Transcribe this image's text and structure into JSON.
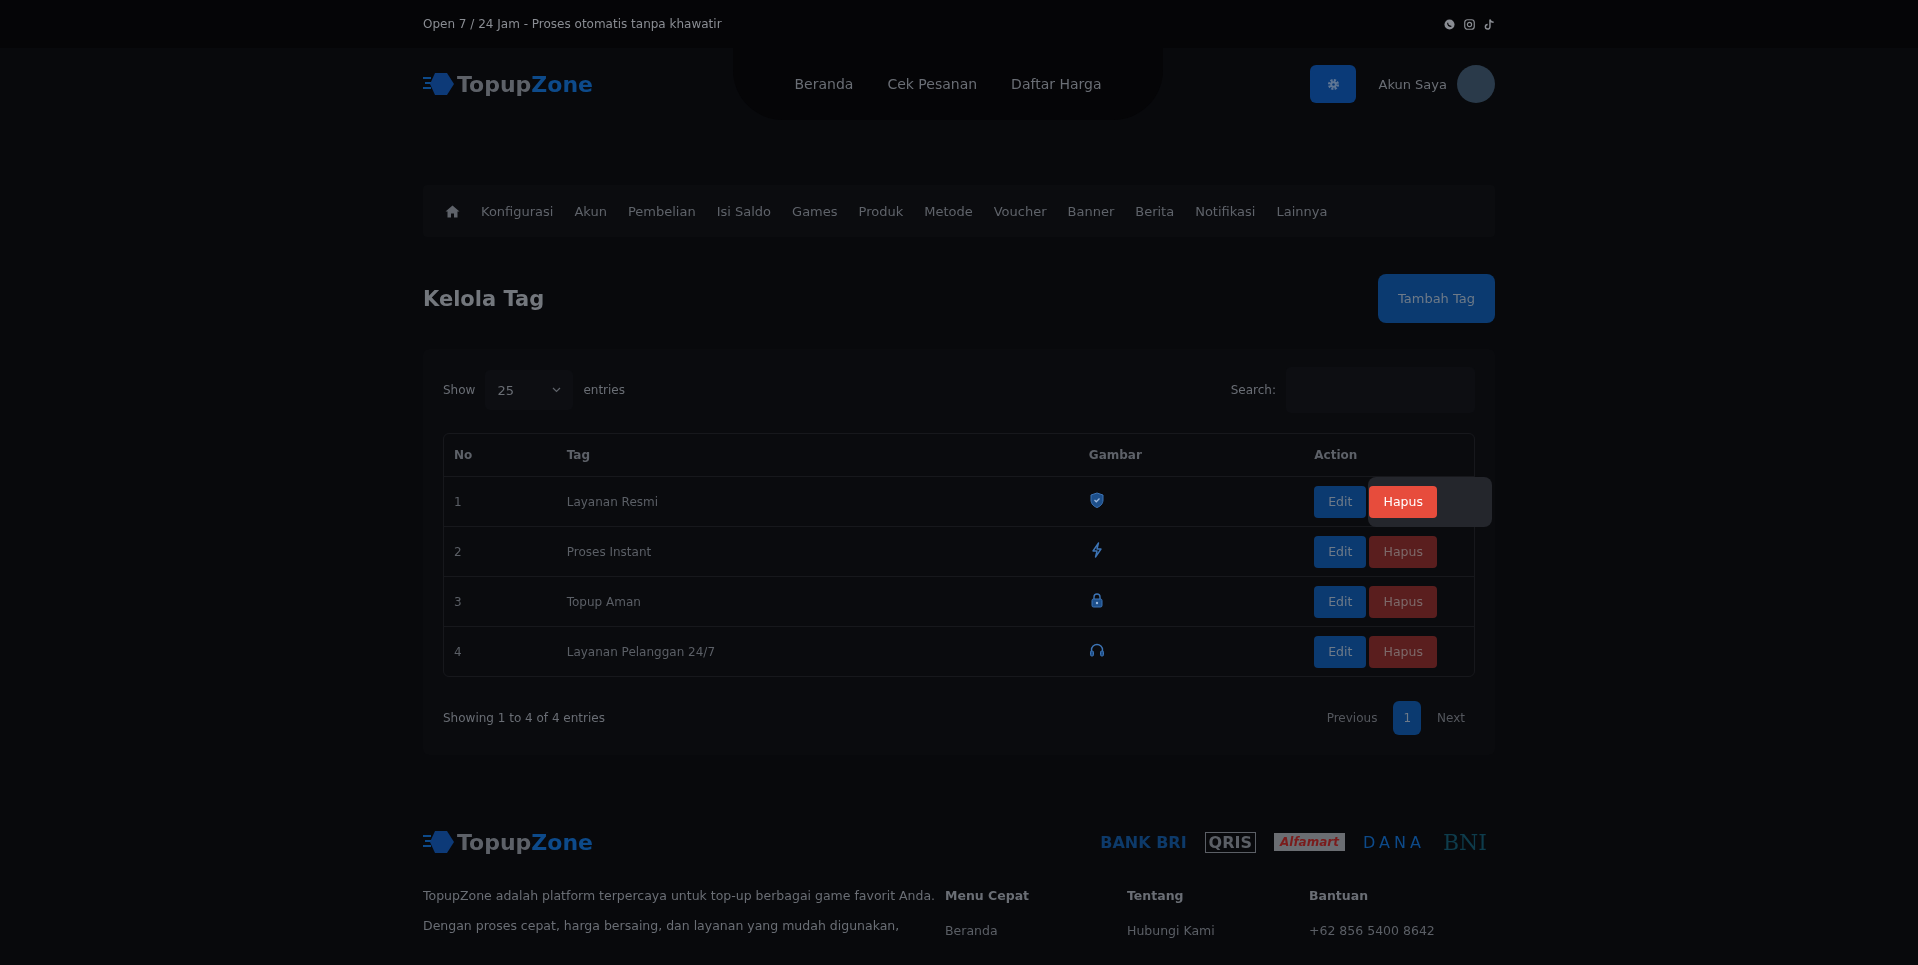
{
  "top_bar": {
    "text": "Open 7 / 24 Jam - Proses otomatis tanpa khawatir"
  },
  "header": {
    "logo": {
      "text": "Topup",
      "accent": "Zone"
    },
    "nav": [
      "Beranda",
      "Cek Pesanan",
      "Daftar Harga"
    ],
    "account": "Akun Saya"
  },
  "admin_menu": [
    "Konfigurasi",
    "Akun",
    "Pembelian",
    "Isi Saldo",
    "Games",
    "Produk",
    "Metode",
    "Voucher",
    "Banner",
    "Berita",
    "Notifikasi",
    "Lainnya"
  ],
  "page": {
    "title": "Kelola Tag",
    "add_button": "Tambah Tag"
  },
  "table_controls": {
    "show_label": "Show",
    "page_size": "25",
    "entries_label": "entries",
    "search_label": "Search:"
  },
  "table": {
    "columns": [
      "No",
      "Tag",
      "Gambar",
      "Action"
    ],
    "rows": [
      {
        "no": "1",
        "tag": "Layanan Resmi",
        "kind": "shield",
        "edit": "Edit",
        "delete": "Hapus",
        "highlighted": true
      },
      {
        "no": "2",
        "tag": "Proses Instant",
        "kind": "bolt",
        "edit": "Edit",
        "delete": "Hapus",
        "highlighted": false
      },
      {
        "no": "3",
        "tag": "Topup Aman",
        "kind": "lock",
        "edit": "Edit",
        "delete": "Hapus",
        "highlighted": false
      },
      {
        "no": "4",
        "tag": "Layanan Pelanggan 24/7",
        "kind": "headset",
        "edit": "Edit",
        "delete": "Hapus",
        "highlighted": false
      }
    ]
  },
  "table_footer": {
    "info": "Showing 1 to 4 of 4 entries",
    "pagination": [
      {
        "label": "Previous",
        "selected": false,
        "disabled": true
      },
      {
        "label": "1",
        "selected": true,
        "disabled": false
      },
      {
        "label": "Next",
        "selected": false,
        "disabled": true
      }
    ]
  },
  "footer": {
    "logo": {
      "text": "Topup",
      "accent": "Zone"
    },
    "payments": [
      {
        "kind": "bri",
        "text": "BANK BRI"
      },
      {
        "kind": "qris",
        "text": "QRIS"
      },
      {
        "kind": "alfamart",
        "text": "Alfamart"
      },
      {
        "kind": "dana",
        "text": "DANA"
      },
      {
        "kind": "bni",
        "text": "BNI"
      }
    ],
    "about_lines": [
      "TopupZone adalah platform terpercaya untuk top-up berbagai game favorit Anda.",
      "Dengan proses cepat, harga bersaing, dan layanan yang mudah digunakan,"
    ],
    "columns": [
      {
        "title": "Menu Cepat",
        "links": [
          "Beranda"
        ]
      },
      {
        "title": "Tentang",
        "links": [
          "Hubungi Kami"
        ]
      },
      {
        "title": "Bantuan",
        "links": [
          "+62 856 5400 8642"
        ]
      }
    ]
  }
}
